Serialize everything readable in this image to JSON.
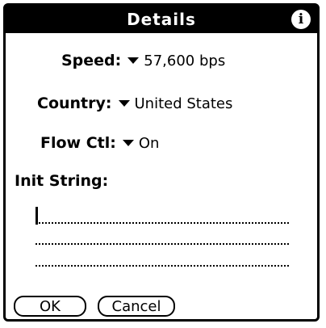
{
  "dialog": {
    "title": "Details",
    "info_icon": "i"
  },
  "fields": {
    "speed": {
      "label": "Speed:",
      "value": "57,600 bps"
    },
    "country": {
      "label": "Country:",
      "value": "United States"
    },
    "flow_ctl": {
      "label": "Flow Ctl:",
      "value": "On"
    }
  },
  "init_string": {
    "label": "Init String:",
    "value": ""
  },
  "buttons": {
    "ok": "OK",
    "cancel": "Cancel"
  },
  "icons": {
    "info": "info-icon",
    "dropdown": "triangle-down-icon"
  }
}
